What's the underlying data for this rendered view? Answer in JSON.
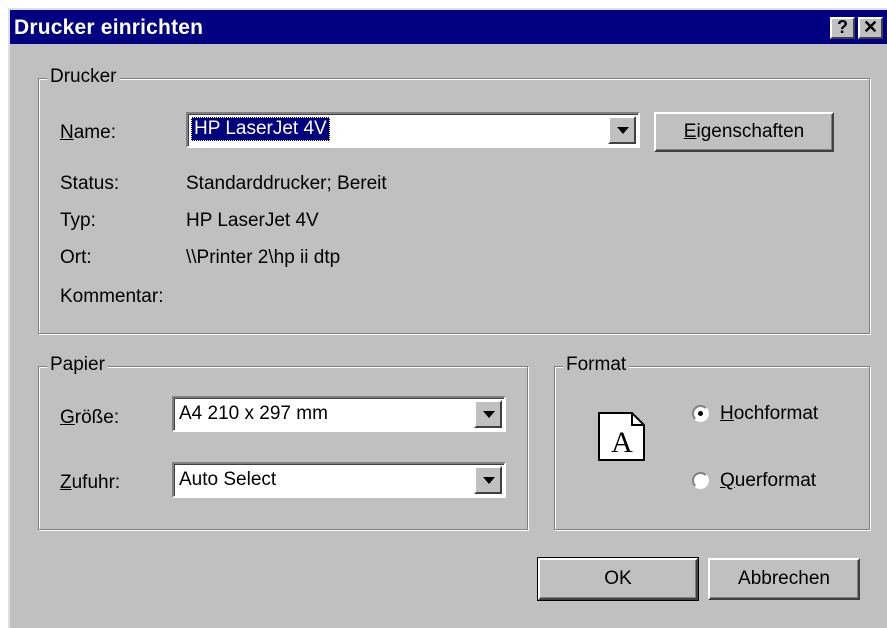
{
  "window": {
    "title": "Drucker einrichten",
    "help_label": "?",
    "close_label": "✕"
  },
  "drucker": {
    "legend": "Drucker",
    "name_label_key": "N",
    "name_label_rest": "ame:",
    "name_value": "HP LaserJet 4V",
    "properties_key": "E",
    "properties_rest": "igenschaften",
    "status_label": "Status:",
    "status_value": "Standarddrucker; Bereit",
    "typ_label": "Typ:",
    "typ_value": "HP LaserJet 4V",
    "ort_label": "Ort:",
    "ort_value": "\\\\Printer 2\\hp ii dtp",
    "kommentar_label": "Kommentar:",
    "kommentar_value": ""
  },
  "papier": {
    "legend": "Papier",
    "size_label_key": "G",
    "size_label_rest": "röße:",
    "size_value": "A4 210 x 297 mm",
    "source_label_key": "Z",
    "source_label_rest": "ufuhr:",
    "source_value": "Auto Select"
  },
  "format": {
    "legend": "Format",
    "icon_letter": "A",
    "portrait_key": "H",
    "portrait_rest": "ochformat",
    "landscape_key": "Q",
    "landscape_rest": "uerformat",
    "selected": "portrait"
  },
  "buttons": {
    "ok": "OK",
    "cancel": "Abbrechen"
  }
}
